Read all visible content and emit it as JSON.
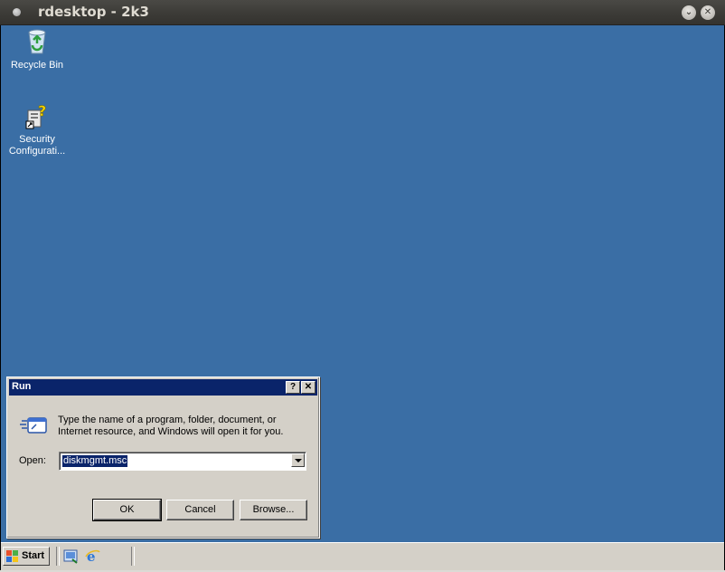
{
  "window": {
    "title": "rdesktop - 2k3",
    "minimize_glyph": "⌄",
    "close_glyph": "✕"
  },
  "desktop": {
    "background": "#3a6ea5",
    "icons": [
      {
        "label": "Recycle Bin",
        "icon": "recycle-bin-icon"
      },
      {
        "label": "Security Configurati...",
        "icon": "security-configuration-icon"
      }
    ]
  },
  "run_dialog": {
    "title": "Run",
    "help_glyph": "?",
    "close_glyph": "✕",
    "description": "Type the name of a program, folder, document, or Internet resource, and Windows will open it for you.",
    "open_label": "Open:",
    "open_value": "diskmgmt.msc",
    "buttons": {
      "ok": "OK",
      "cancel": "Cancel",
      "browse": "Browse..."
    }
  },
  "taskbar": {
    "start_label": "Start",
    "quick_launch": [
      "show-desktop-icon",
      "internet-explorer-icon"
    ]
  }
}
